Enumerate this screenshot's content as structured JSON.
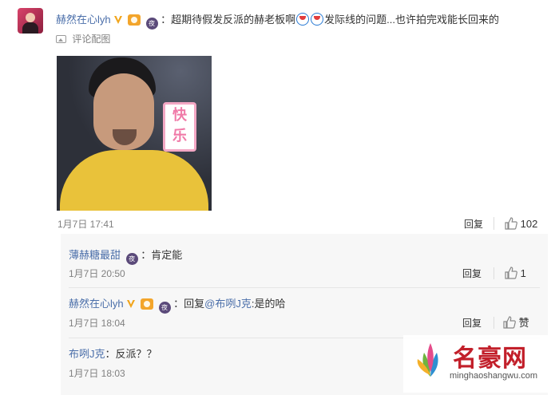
{
  "main_comment": {
    "username": "赫然在心lyh",
    "text_before_emoji": "：超期待假发反派的赫老板啊",
    "text_after_emoji": "发际线的问题...也许拍完戏能长回来的",
    "view_image_label": "评论配图",
    "sticker_text": [
      "快",
      "乐"
    ],
    "time": "1月7日 17:41",
    "reply_label": "回复",
    "like_count": "102"
  },
  "replies": [
    {
      "username": "薄赫糖最甜",
      "text": "：肯定能",
      "time": "1月7日 20:50",
      "reply_label": "回复",
      "like_label": "1"
    },
    {
      "username": "赫然在心lyh",
      "reply_prefix": "：回复",
      "mention": "@布咧J克",
      "text": ":是的哈",
      "time": "1月7日 18:04",
      "reply_label": "回复",
      "like_label": "赞"
    },
    {
      "username": "布咧J克",
      "text": "：反派？？",
      "time": "1月7日 18:03"
    }
  ],
  "watermark": {
    "name": "名豪网",
    "url": "minghaoshangwu.com"
  },
  "colors": {
    "link": "#4a6ea9",
    "muted": "#808080",
    "accent_badge": "#f3a52b",
    "watermark_red": "#c21f2a"
  }
}
